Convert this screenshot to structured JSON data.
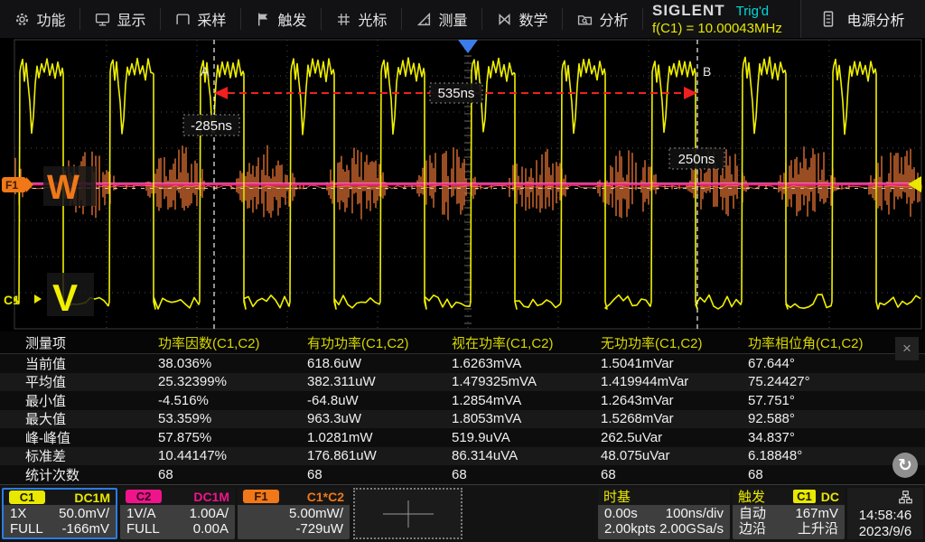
{
  "menu": {
    "items": [
      {
        "icon": "gear-icon",
        "label": "功能"
      },
      {
        "icon": "display-icon",
        "label": "显示"
      },
      {
        "icon": "acquire-icon",
        "label": "采样"
      },
      {
        "icon": "trigger-flag-icon",
        "label": "触发"
      },
      {
        "icon": "cursors-icon",
        "label": "光标"
      },
      {
        "icon": "measure-icon",
        "label": "测量"
      },
      {
        "icon": "math-icon",
        "label": "数学"
      },
      {
        "icon": "analysis-icon",
        "label": "分析"
      }
    ]
  },
  "status": {
    "brand": "SIGLENT",
    "trigger_status": "Trig'd",
    "freq_readout": "f(C1) = 10.00043MHz",
    "power_analysis_label": "电源分析"
  },
  "waveform": {
    "cursor_a_label": "A",
    "cursor_b_label": "B",
    "cursor_a_time": "-285ns",
    "cursor_b_time": "250ns",
    "delta_time": "535ns",
    "f1_marker": "F1",
    "f1_unit": "W",
    "c1_marker": "C1",
    "c1_unit": "V"
  },
  "chart_data": {
    "type": "line",
    "title": "oscilloscope graticule 10x8 divisions",
    "x_axis": {
      "scale": "100ns/div",
      "divisions": 10
    },
    "y_axis": {
      "divisions": 8
    },
    "traces": [
      {
        "name": "C1",
        "color": "#f0f000",
        "description": "10.00043MHz square wave with ringing and notch, 50.0mV/div, offset -166mV"
      },
      {
        "name": "C2",
        "color": "#ff1e96",
        "description": "flat current trace at 0.00A, 1.00A/div"
      },
      {
        "name": "F1 = C1*C2",
        "color": "#ff8038",
        "description": "power spike bursts during C1 low half-periods, 5.00mW/div, offset -729uW"
      }
    ],
    "cursors": {
      "a": "-285ns",
      "b": "250ns",
      "delta": "535ns"
    }
  },
  "measurements": {
    "columns": [
      "测量项",
      "功率因数(C1,C2)",
      "有功功率(C1,C2)",
      "视在功率(C1,C2)",
      "无功功率(C1,C2)",
      "功率相位角(C1,C2)"
    ],
    "rows": [
      {
        "label": "当前值",
        "values": [
          "38.036%",
          "618.6uW",
          "1.6263mVA",
          "1.5041mVar",
          "67.644°"
        ]
      },
      {
        "label": "平均值",
        "values": [
          "25.32399%",
          "382.311uW",
          "1.479325mVA",
          "1.419944mVar",
          "75.24427°"
        ]
      },
      {
        "label": "最小值",
        "values": [
          "-4.516%",
          "-64.8uW",
          "1.2854mVA",
          "1.2643mVar",
          "57.751°"
        ]
      },
      {
        "label": "最大值",
        "values": [
          "53.359%",
          "963.3uW",
          "1.8053mVA",
          "1.5268mVar",
          "92.588°"
        ]
      },
      {
        "label": "峰-峰值",
        "values": [
          "57.875%",
          "1.0281mW",
          "519.9uVA",
          "262.5uVar",
          "34.837°"
        ]
      },
      {
        "label": "标准差",
        "values": [
          "10.44147%",
          "176.861uW",
          "86.314uVA",
          "48.075uVar",
          "6.18848°"
        ]
      },
      {
        "label": "统计次数",
        "values": [
          "68",
          "68",
          "68",
          "68",
          "68"
        ]
      }
    ],
    "close_glyph": "×",
    "refresh_glyph": "↻"
  },
  "channels": {
    "c1": {
      "name": "C1",
      "coupling": "DC1M",
      "atten": "1X",
      "scale": "50.0mV/",
      "bandwidth": "FULL",
      "offset": "-166mV",
      "color": "#e8e800"
    },
    "c2": {
      "name": "C2",
      "coupling": "DC1M",
      "atten": "1V/A",
      "scale": "1.00A/",
      "bandwidth": "FULL",
      "offset": "0.00A",
      "color": "#f0148c"
    },
    "f1": {
      "name": "F1",
      "source": "C1*C2",
      "scale": "5.00mW/",
      "offset": "-729uW",
      "color": "#f07818"
    }
  },
  "timebase": {
    "title": "时基",
    "delay": "0.00s",
    "scale": "100ns/div",
    "points": "2.00kpts",
    "rate": "2.00GSa/s"
  },
  "trigger": {
    "title": "触发",
    "source": "C1",
    "coupling": "DC",
    "mode": "自动",
    "level": "167mV",
    "type": "边沿",
    "slope": "上升沿"
  },
  "clock": {
    "time": "14:58:46",
    "date": "2023/9/6"
  }
}
